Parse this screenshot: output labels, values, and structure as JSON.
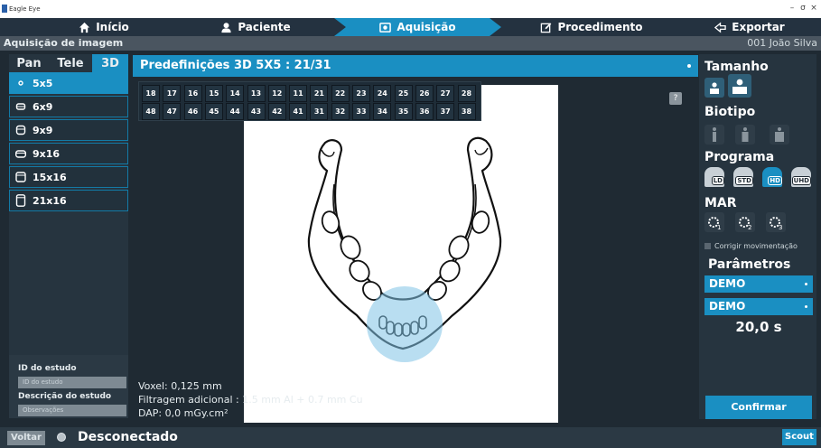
{
  "window": {
    "title": "Eagle Eye",
    "min": "–",
    "max": "σ",
    "close": "×"
  },
  "nav": [
    {
      "label": "Início",
      "icon": "home-icon"
    },
    {
      "label": "Paciente",
      "icon": "user-icon"
    },
    {
      "label": "Aquisição",
      "icon": "camera-icon",
      "active": true
    },
    {
      "label": "Procedimento",
      "icon": "edit-icon"
    },
    {
      "label": "Exportar",
      "icon": "export-icon"
    }
  ],
  "subheader": {
    "title": "Aquisição de imagem",
    "patient": "001 João Silva"
  },
  "modes": [
    {
      "label": "Pan"
    },
    {
      "label": "Tele"
    },
    {
      "label": "3D",
      "active": true
    }
  ],
  "volumes": [
    {
      "label": "5x5",
      "active": true
    },
    {
      "label": "6x9"
    },
    {
      "label": "9x9"
    },
    {
      "label": "9x16"
    },
    {
      "label": "15x16"
    },
    {
      "label": "21x16"
    }
  ],
  "preset": {
    "title": "Predefinições 3D 5X5 : 21/31"
  },
  "teeth": {
    "upper": [
      "18",
      "17",
      "16",
      "15",
      "14",
      "13",
      "12",
      "11",
      "21",
      "22",
      "23",
      "24",
      "25",
      "26",
      "27",
      "28"
    ],
    "lower": [
      "48",
      "47",
      "46",
      "45",
      "44",
      "43",
      "42",
      "41",
      "31",
      "32",
      "33",
      "34",
      "35",
      "36",
      "37",
      "38"
    ]
  },
  "study": {
    "id_label": "ID do estudo",
    "id_placeholder": "ID do estudo",
    "desc_label": "Descrição do estudo",
    "desc_placeholder": "Observações"
  },
  "info": {
    "voxel": "Voxel: 0,125 mm",
    "filter": "Filtragem adicional : 1.5 mm Al + 0.7 mm Cu",
    "dap": "DAP: 0,0 mGy.cm²"
  },
  "help": "?",
  "right": {
    "size_label": "Tamanho",
    "biotype_label": "Biotipo",
    "program_label": "Programa",
    "programs": [
      "LD",
      "STD",
      "HD",
      "UHD"
    ],
    "selected_program": "HD",
    "mar_label": "MAR",
    "mar_levels": [
      "1",
      "2",
      "3"
    ],
    "motion_label": "Corrigir movimentação",
    "params_label": "Parâmetros",
    "param1": "DEMO",
    "param2": "DEMO",
    "time": "20,0 s",
    "confirm": "Confirmar"
  },
  "status": {
    "back": "Voltar",
    "connection": "Desconectado",
    "scout": "Scout"
  },
  "colors": {
    "accent": "#1a8fc2",
    "panel": "#26343f",
    "background": "#1f2a33"
  }
}
